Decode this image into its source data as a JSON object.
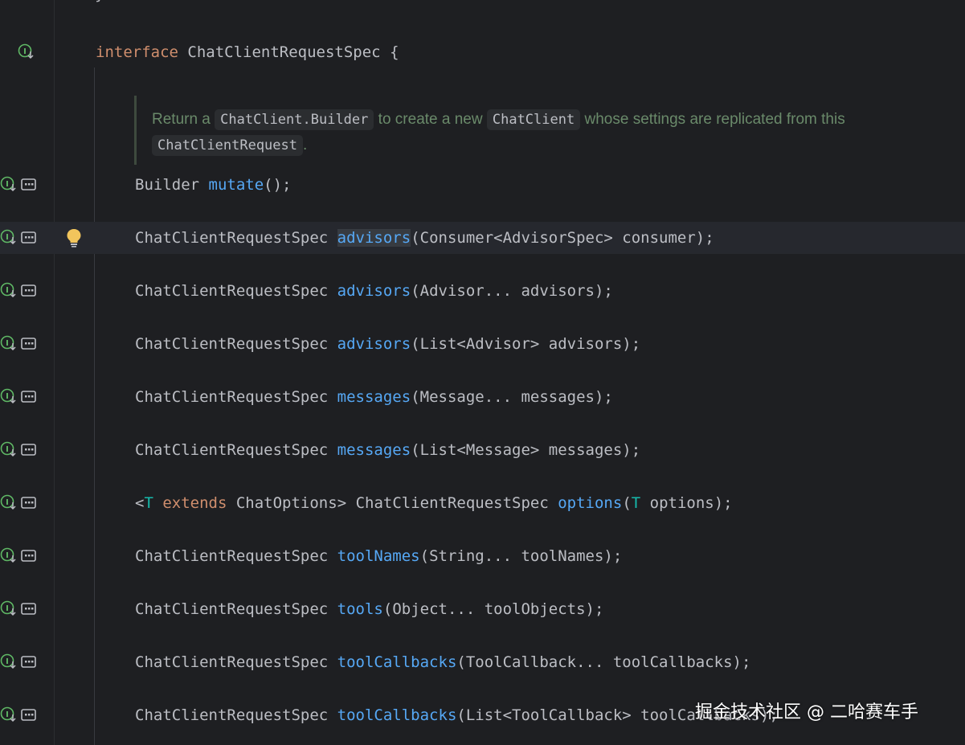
{
  "editor": {
    "prev_line": "}",
    "interface_line": {
      "keyword": "interface",
      "name": "ChatClientRequestSpec",
      "brace": "{"
    },
    "javadoc": {
      "t1": "Return a ",
      "c1": "ChatClient.Builder",
      "t2": " to create a new ",
      "c2": "ChatClient",
      "t3": " whose settings are replicated from this ",
      "c3": "ChatClientRequest",
      "t4": "."
    },
    "methods": [
      {
        "ret": "Builder ",
        "name": "mutate",
        "params": "();"
      },
      {
        "ret": "ChatClientRequestSpec ",
        "name": "advisors",
        "params": "(Consumer<AdvisorSpec> consumer);"
      },
      {
        "ret": "ChatClientRequestSpec ",
        "name": "advisors",
        "params": "(Advisor... advisors);"
      },
      {
        "ret": "ChatClientRequestSpec ",
        "name": "advisors",
        "params": "(List<Advisor> advisors);"
      },
      {
        "ret": "ChatClientRequestSpec ",
        "name": "messages",
        "params": "(Message... messages);"
      },
      {
        "ret": "ChatClientRequestSpec ",
        "name": "messages",
        "params": "(List<Message> messages);"
      },
      {
        "generic_open": "<",
        "type_param": "T",
        "extends_kw": " extends ",
        "generic_rest": "ChatOptions> ChatClientRequestSpec ",
        "name": "options",
        "paren": "(",
        "param_type": "T",
        "params_rest": " options);"
      },
      {
        "ret": "ChatClientRequestSpec ",
        "name": "toolNames",
        "params": "(String... toolNames);"
      },
      {
        "ret": "ChatClientRequestSpec ",
        "name": "tools",
        "params": "(Object... toolObjects);"
      },
      {
        "ret": "ChatClientRequestSpec ",
        "name": "toolCallbacks",
        "params": "(ToolCallback... toolCallbacks);"
      },
      {
        "ret": "ChatClientRequestSpec ",
        "name": "toolCallbacks",
        "params": "(List<ToolCallback> toolCallbacks);"
      }
    ]
  },
  "gutter_icons": {
    "interface": "interface-implemented-icon",
    "method_impl": "implemented-method-icon",
    "method_usage": "usages-icon",
    "intention": "lightbulb-icon"
  },
  "colors": {
    "background": "#1e1f22",
    "keyword": "#cf8e6d",
    "function": "#56a8f5",
    "type_param": "#16baac",
    "text": "#bcbec4",
    "doc_text": "#6a8a6a"
  },
  "watermark": "掘金技术社区 @ 二哈赛车手"
}
